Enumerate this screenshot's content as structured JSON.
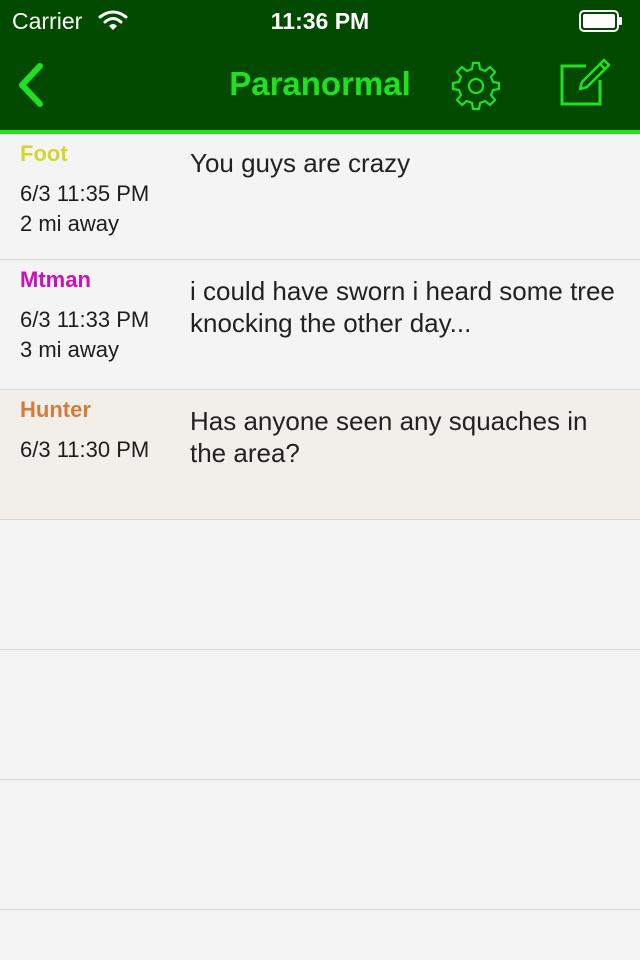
{
  "status_bar": {
    "carrier": "Carrier",
    "time": "11:36 PM"
  },
  "nav": {
    "title": "Paranormal",
    "back_icon": "chevron-left-icon",
    "settings_icon": "gear-icon",
    "compose_icon": "compose-icon"
  },
  "colors": {
    "header_bg": "#024a00",
    "accent": "#21e01f",
    "list_bg": "#f4f4f4",
    "highlight_bg": "#f2efeb",
    "name_foot": "#d2d730",
    "name_mtman": "#cc10b8",
    "name_hunter": "#d57b3a"
  },
  "posts": [
    {
      "name": "Foot",
      "date": "6/3 11:35 PM",
      "distance": "2 mi away",
      "message": "You guys are crazy"
    },
    {
      "name": "Mtman",
      "date": "6/3 11:33 PM",
      "distance": "3 mi away",
      "message": "i could have sworn i heard some tree knocking the other day..."
    },
    {
      "name": "Hunter",
      "date": "6/3 11:30 PM",
      "distance": "",
      "message": "Has anyone seen any squaches in the area?"
    }
  ]
}
